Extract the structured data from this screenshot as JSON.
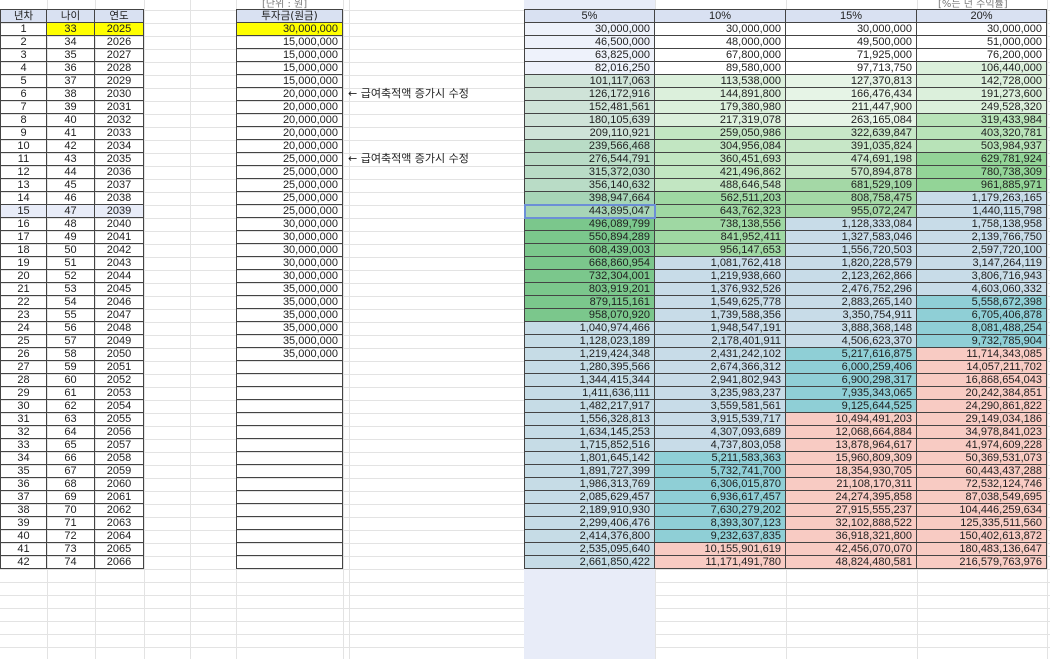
{
  "units": {
    "left": "[단위 : 원]",
    "right": "[%는 년 수익률]"
  },
  "left_table": {
    "headers": [
      "년차",
      "나이",
      "연도",
      "투자금(원금)"
    ],
    "rows": [
      [
        "1",
        "33",
        "2025",
        "30,000,000"
      ],
      [
        "2",
        "34",
        "2026",
        "15,000,000"
      ],
      [
        "3",
        "35",
        "2027",
        "15,000,000"
      ],
      [
        "4",
        "36",
        "2028",
        "15,000,000"
      ],
      [
        "5",
        "37",
        "2029",
        "15,000,000"
      ],
      [
        "6",
        "38",
        "2030",
        "20,000,000"
      ],
      [
        "7",
        "39",
        "2031",
        "20,000,000"
      ],
      [
        "8",
        "40",
        "2032",
        "20,000,000"
      ],
      [
        "9",
        "41",
        "2033",
        "20,000,000"
      ],
      [
        "10",
        "42",
        "2034",
        "20,000,000"
      ],
      [
        "11",
        "43",
        "2035",
        "25,000,000"
      ],
      [
        "12",
        "44",
        "2036",
        "25,000,000"
      ],
      [
        "13",
        "45",
        "2037",
        "25,000,000"
      ],
      [
        "14",
        "46",
        "2038",
        "25,000,000"
      ],
      [
        "15",
        "47",
        "2039",
        "25,000,000"
      ],
      [
        "16",
        "48",
        "2040",
        "30,000,000"
      ],
      [
        "17",
        "49",
        "2041",
        "30,000,000"
      ],
      [
        "18",
        "50",
        "2042",
        "30,000,000"
      ],
      [
        "19",
        "51",
        "2043",
        "30,000,000"
      ],
      [
        "20",
        "52",
        "2044",
        "30,000,000"
      ],
      [
        "21",
        "53",
        "2045",
        "35,000,000"
      ],
      [
        "22",
        "54",
        "2046",
        "35,000,000"
      ],
      [
        "23",
        "55",
        "2047",
        "35,000,000"
      ],
      [
        "24",
        "56",
        "2048",
        "35,000,000"
      ],
      [
        "25",
        "57",
        "2049",
        "35,000,000"
      ],
      [
        "26",
        "58",
        "2050",
        "35,000,000"
      ],
      [
        "27",
        "59",
        "2051",
        ""
      ],
      [
        "28",
        "60",
        "2052",
        ""
      ],
      [
        "29",
        "61",
        "2053",
        ""
      ],
      [
        "30",
        "62",
        "2054",
        ""
      ],
      [
        "31",
        "63",
        "2055",
        ""
      ],
      [
        "32",
        "64",
        "2056",
        ""
      ],
      [
        "33",
        "65",
        "2057",
        ""
      ],
      [
        "34",
        "66",
        "2058",
        ""
      ],
      [
        "35",
        "67",
        "2059",
        ""
      ],
      [
        "36",
        "68",
        "2060",
        ""
      ],
      [
        "37",
        "69",
        "2061",
        ""
      ],
      [
        "38",
        "70",
        "2062",
        ""
      ],
      [
        "39",
        "71",
        "2063",
        ""
      ],
      [
        "40",
        "72",
        "2064",
        ""
      ],
      [
        "41",
        "73",
        "2065",
        ""
      ],
      [
        "42",
        "74",
        "2066",
        ""
      ]
    ]
  },
  "notes": [
    {
      "row": 5,
      "text": "← 급여축적액 증가시 수정"
    },
    {
      "row": 10,
      "text": "← 급여축적액 증가시 수정"
    }
  ],
  "right_table": {
    "headers": [
      "5%",
      "10%",
      "15%",
      "20%"
    ],
    "rows": [
      [
        "30,000,000",
        "30,000,000",
        "30,000,000",
        "30,000,000"
      ],
      [
        "46,500,000",
        "48,000,000",
        "49,500,000",
        "51,000,000"
      ],
      [
        "63,825,000",
        "67,800,000",
        "71,925,000",
        "76,200,000"
      ],
      [
        "82,016,250",
        "89,580,000",
        "97,713,750",
        "106,440,000"
      ],
      [
        "101,117,063",
        "113,538,000",
        "127,370,813",
        "142,728,000"
      ],
      [
        "126,172,916",
        "144,891,800",
        "166,476,434",
        "191,273,600"
      ],
      [
        "152,481,561",
        "179,380,980",
        "211,447,900",
        "249,528,320"
      ],
      [
        "180,105,639",
        "217,319,078",
        "263,165,084",
        "319,433,984"
      ],
      [
        "209,110,921",
        "259,050,986",
        "322,639,847",
        "403,320,781"
      ],
      [
        "239,566,468",
        "304,956,084",
        "391,035,824",
        "503,984,937"
      ],
      [
        "276,544,791",
        "360,451,693",
        "474,691,198",
        "629,781,924"
      ],
      [
        "315,372,030",
        "421,496,862",
        "570,894,878",
        "780,738,309"
      ],
      [
        "356,140,632",
        "488,646,548",
        "681,529,109",
        "961,885,971"
      ],
      [
        "398,947,664",
        "562,511,203",
        "808,758,475",
        "1,179,263,165"
      ],
      [
        "443,895,047",
        "643,762,323",
        "955,072,247",
        "1,440,115,798"
      ],
      [
        "496,089,799",
        "738,138,556",
        "1,128,333,084",
        "1,758,138,958"
      ],
      [
        "550,894,289",
        "841,952,411",
        "1,327,583,046",
        "2,139,766,750"
      ],
      [
        "608,439,003",
        "956,147,653",
        "1,556,720,503",
        "2,597,720,100"
      ],
      [
        "668,860,954",
        "1,081,762,418",
        "1,820,228,579",
        "3,147,264,119"
      ],
      [
        "732,304,001",
        "1,219,938,660",
        "2,123,262,866",
        "3,806,716,943"
      ],
      [
        "803,919,201",
        "1,376,932,526",
        "2,476,752,296",
        "4,603,060,332"
      ],
      [
        "879,115,161",
        "1,549,625,778",
        "2,883,265,140",
        "5,558,672,398"
      ],
      [
        "958,070,920",
        "1,739,588,356",
        "3,350,754,911",
        "6,705,406,878"
      ],
      [
        "1,040,974,466",
        "1,948,547,191",
        "3,888,368,148",
        "8,081,488,254"
      ],
      [
        "1,128,023,189",
        "2,178,401,911",
        "4,506,623,370",
        "9,732,785,904"
      ],
      [
        "1,219,424,348",
        "2,431,242,102",
        "5,217,616,875",
        "11,714,343,085"
      ],
      [
        "1,280,395,566",
        "2,674,366,312",
        "6,000,259,406",
        "14,057,211,702"
      ],
      [
        "1,344,415,344",
        "2,941,802,943",
        "6,900,298,317",
        "16,868,654,043"
      ],
      [
        "1,411,636,111",
        "3,235,983,237",
        "7,935,343,065",
        "20,242,384,851"
      ],
      [
        "1,482,217,917",
        "3,559,581,561",
        "9,125,644,525",
        "24,290,861,822"
      ],
      [
        "1,556,328,813",
        "3,915,539,717",
        "10,494,491,203",
        "29,149,034,186"
      ],
      [
        "1,634,145,253",
        "4,307,093,689",
        "12,068,664,884",
        "34,978,841,023"
      ],
      [
        "1,715,852,516",
        "4,737,803,058",
        "13,878,964,617",
        "41,974,609,228"
      ],
      [
        "1,801,645,142",
        "5,211,583,363",
        "15,960,809,309",
        "50,369,531,073"
      ],
      [
        "1,891,727,399",
        "5,732,741,700",
        "18,354,930,705",
        "60,443,437,288"
      ],
      [
        "1,986,313,769",
        "6,306,015,870",
        "21,108,170,311",
        "72,532,124,746"
      ],
      [
        "2,085,629,457",
        "6,936,617,457",
        "24,274,395,858",
        "87,038,549,695"
      ],
      [
        "2,189,910,930",
        "7,630,279,202",
        "27,915,555,237",
        "104,446,259,634"
      ],
      [
        "2,299,406,476",
        "8,393,307,123",
        "32,102,888,522",
        "125,335,511,560"
      ],
      [
        "2,414,376,800",
        "9,232,637,835",
        "36,918,321,800",
        "150,402,613,872"
      ],
      [
        "2,535,095,640",
        "10,155,901,619",
        "42,456,070,070",
        "180,483,136,647"
      ],
      [
        "2,661,850,422",
        "11,171,491,780",
        "48,824,480,581",
        "216,579,763,976"
      ]
    ]
  },
  "colors": {
    "header_bg": "#d9e1f2",
    "highlight_yellow": "#ffff00",
    "selection_border": "#6c8fd6",
    "selected_row_bg": "#e8ecf8"
  }
}
